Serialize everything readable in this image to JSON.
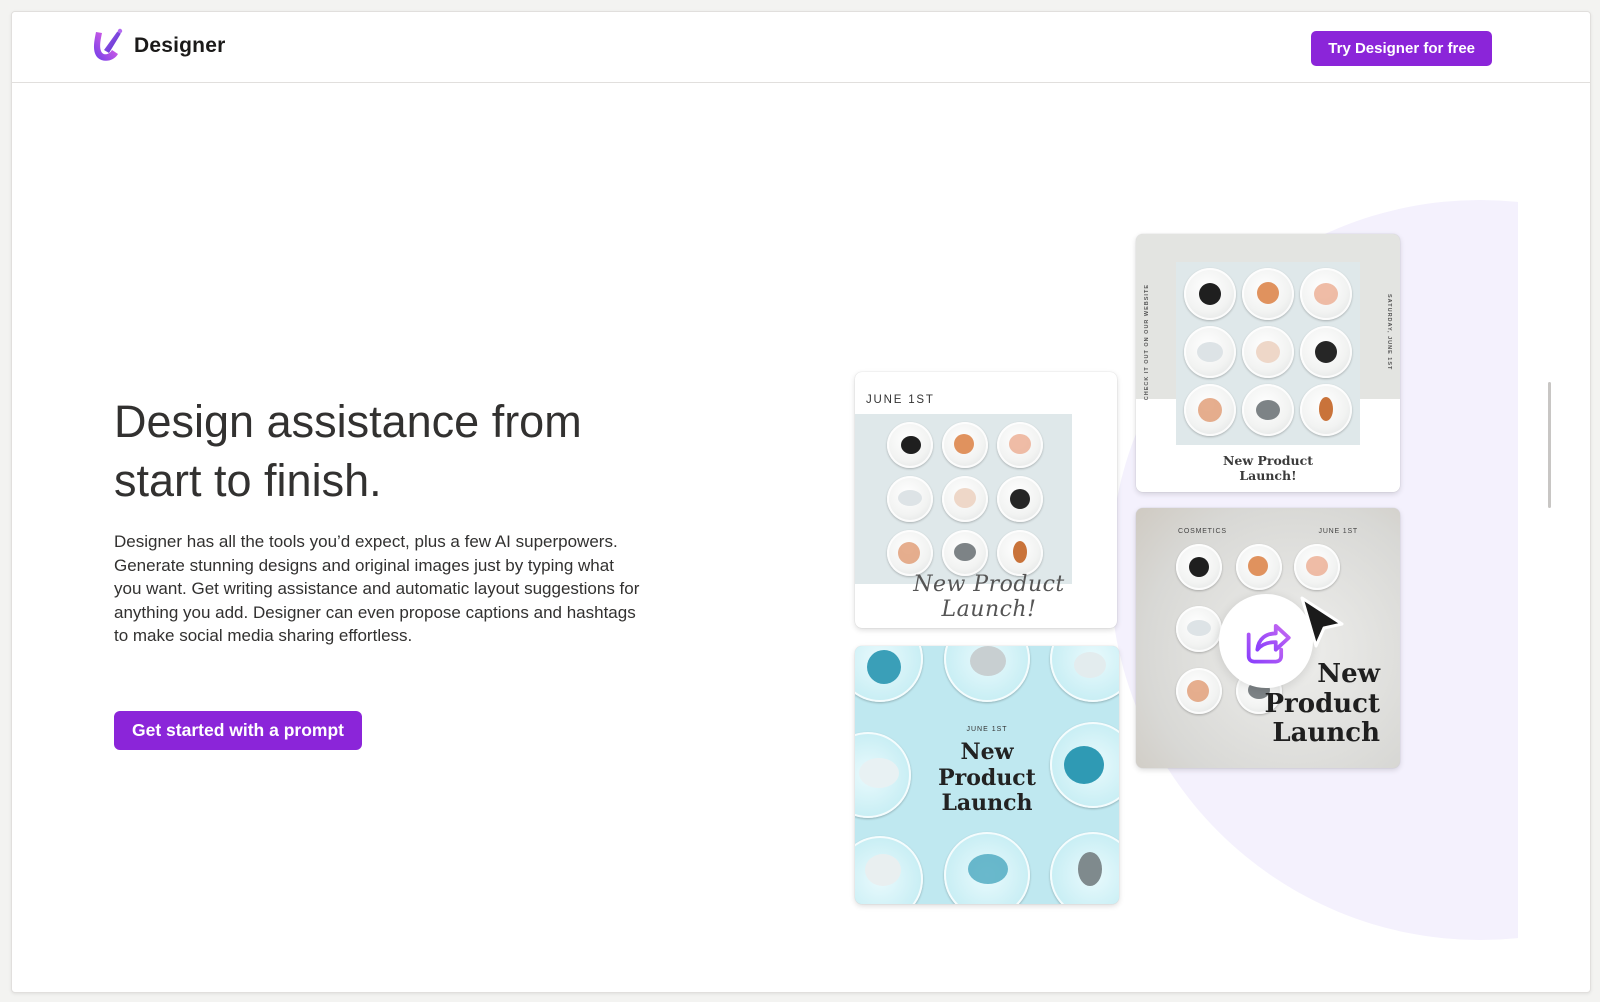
{
  "header": {
    "brand_name": "Designer",
    "logo_icon": "designer-logo-icon",
    "try_button_label": "Try Designer for free"
  },
  "hero": {
    "title_line1": "Design assistance from",
    "title_line2": "start to finish.",
    "description": "Designer has all the tools you’d expect, plus a few AI superpowers. Generate stunning designs and original images just by typing what you want. Get writing assistance and automatic layout suggestions for anything you add. Designer can even propose captions and hashtags to make social media sharing effortless.",
    "cta_label": "Get started with a prompt"
  },
  "samples": {
    "card_a": {
      "date": "JUNE 1ST",
      "script_text": "New Product Launch!"
    },
    "card_b": {
      "title_line1": "New Product",
      "title_line2": "Launch!",
      "side_left": "CHECK IT OUT ON OUR WEBSITE",
      "side_right": "SATURDAY, JUNE 1ST"
    },
    "card_c": {
      "date": "JUNE 1ST",
      "title_line1": "New",
      "title_line2": "Product",
      "title_line3": "Launch"
    },
    "card_d": {
      "label_left": "COSMETICS",
      "label_right": "JUNE 1ST",
      "title_line1": "New",
      "title_line2": "Product",
      "title_line3": "Launch",
      "share_icon": "share-icon",
      "pointer_icon": "mouse-pointer-icon"
    }
  },
  "colors": {
    "accent": "#8b25d9",
    "text": "#323130",
    "circle_bg": "#f4f1fd"
  }
}
